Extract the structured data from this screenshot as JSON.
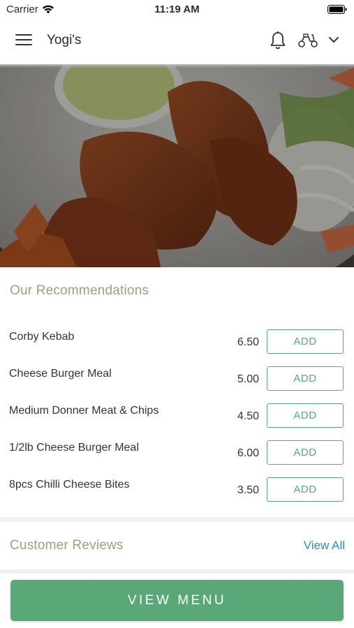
{
  "status_bar": {
    "carrier": "Carrier",
    "time": "11:19 AM"
  },
  "header": {
    "title": "Yogi's"
  },
  "recommendations": {
    "title": "Our Recommendations",
    "add_label": "ADD",
    "items": [
      {
        "name": "Corby Kebab",
        "price": "6.50"
      },
      {
        "name": "Cheese Burger Meal",
        "price": "5.00"
      },
      {
        "name": "Medium Donner Meat & Chips",
        "price": "4.50"
      },
      {
        "name": "1/2lb Cheese Burger Meal",
        "price": "6.00"
      },
      {
        "name": "8pcs Chilli Cheese Bites",
        "price": "3.50"
      }
    ]
  },
  "reviews": {
    "title": "Customer Reviews",
    "view_all": "View All"
  },
  "footer": {
    "view_menu": "VIEW MENU"
  },
  "colors": {
    "accent_green": "#5aa877",
    "section_title": "#a89b7a",
    "link_blue": "#2c8bc7"
  }
}
